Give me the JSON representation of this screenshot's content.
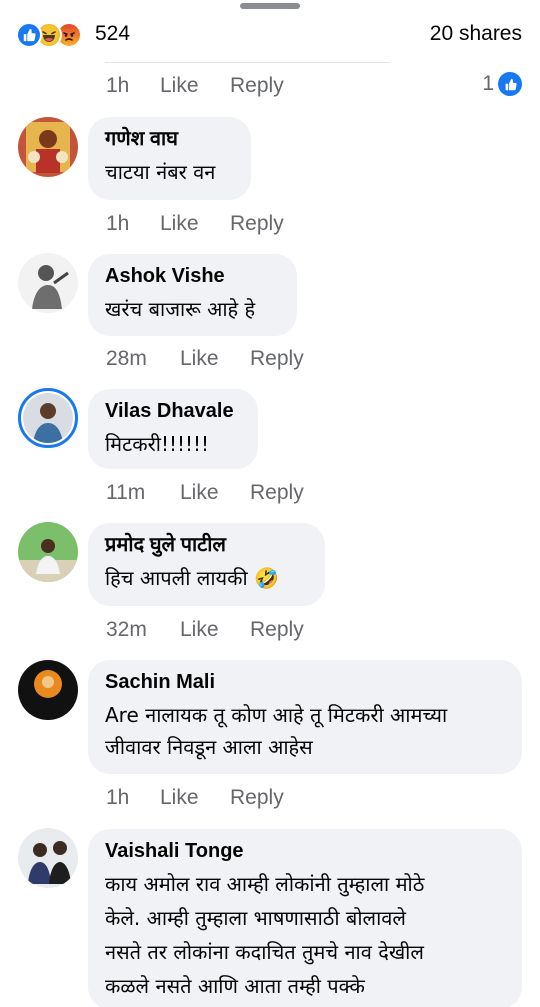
{
  "reactions": {
    "icons": [
      "like-icon",
      "haha-icon",
      "angry-icon"
    ],
    "count": "524",
    "shares": "20 shares"
  },
  "colors": {
    "like_blue": "#1877f2",
    "bubble_bg": "#f0f2f5",
    "meta_gray": "#65676b"
  },
  "previous_comment": {
    "time": "1h",
    "like_label": "Like",
    "reply_label": "Reply",
    "like_count": "1"
  },
  "comments": [
    {
      "author": "गणेश वाघ",
      "text": "चाटया नंबर वन",
      "time": "1h",
      "like_label": "Like",
      "reply_label": "Reply"
    },
    {
      "author": "Ashok Vishe",
      "text": "खरंच बाजारू आहे हे",
      "time": "28m",
      "like_label": "Like",
      "reply_label": "Reply"
    },
    {
      "author": "Vilas Dhavale",
      "text": "मिटकरी!!!!!!",
      "time": "11m",
      "like_label": "Like",
      "reply_label": "Reply"
    },
    {
      "author": "प्रमोद घुले पाटील",
      "text": "हिच आपली लायकी",
      "emoji": "🤣",
      "time": "32m",
      "like_label": "Like",
      "reply_label": "Reply"
    },
    {
      "author": "Sachin Mali",
      "text_line1": "Are नालायक तू कोण आहे तू मिटकरी आमच्या",
      "text_line2": "जीवावर निवडून आला आहेस",
      "time": "1h",
      "like_label": "Like",
      "reply_label": "Reply"
    },
    {
      "author": "Vaishali Tonge",
      "text_line1": "काय अमोल राव आम्ही लोकांनी तुम्हाला मोठे",
      "text_line2": "केले. आम्ही तुम्हाला भाषणासाठी बोलावले",
      "text_line3": "नसते तर लोकांना कदाचित तुमचे नाव देखील",
      "text_line4": "कळले नसते आणि आता तम्ही पक्के"
    }
  ]
}
